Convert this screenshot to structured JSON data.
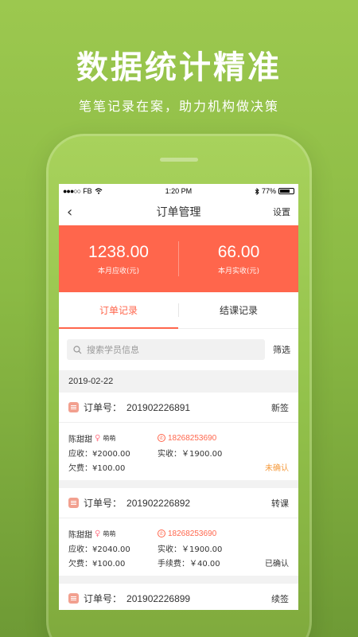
{
  "promo": {
    "title": "数据统计精准",
    "subtitle": "笔笔记录在案，助力机构做决策"
  },
  "statusbar": {
    "carrier": "FB",
    "time": "1:20 PM",
    "battery": "77%",
    "battery_level": 0.77
  },
  "navbar": {
    "title": "订单管理",
    "settings_label": "设置"
  },
  "summary": [
    {
      "value": "1238.00",
      "label": "本月应收(元)"
    },
    {
      "value": "66.00",
      "label": "本月实收(元)"
    }
  ],
  "tabs": [
    {
      "label": "订单记录",
      "active": true
    },
    {
      "label": "结课记录",
      "active": false
    }
  ],
  "search": {
    "placeholder": "搜索学员信息",
    "filter_label": "筛选"
  },
  "date": "2019-02-22",
  "orders": [
    {
      "order_label": "订单号：",
      "order_no": "201902226891",
      "type": "新签",
      "student": "陈甜甜",
      "nickname": "萌萌",
      "phone": "18268253690",
      "receivable": "应收：¥2000.00",
      "received": "实收：￥1900.00",
      "arrears": "欠费：¥100.00",
      "fee": "",
      "status": "未确认",
      "status_color": "#f59a3c"
    },
    {
      "order_label": "订单号：",
      "order_no": "201902226892",
      "type": "转课",
      "student": "陈甜甜",
      "nickname": "萌萌",
      "phone": "18268253690",
      "receivable": "应收：¥2040.00",
      "received": "实收：￥1900.00",
      "arrears": "欠费：¥100.00",
      "fee": "手续费：￥40.00",
      "status": "已确认",
      "status_color": "#333333"
    },
    {
      "order_label": "订单号：",
      "order_no": "201902226899",
      "type": "续签"
    }
  ]
}
